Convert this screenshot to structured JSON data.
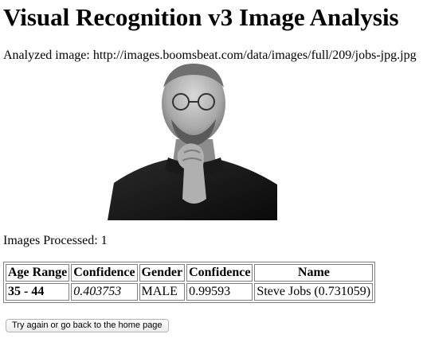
{
  "page": {
    "title": "Visual Recognition v3 Image Analysis",
    "analyzed_label": "Analyzed image: ",
    "analyzed_url": "http://images.boomsbeat.com/data/images/full/209/jobs-jpg.jpg",
    "processed_label": "Images Processed: ",
    "processed_count": "1"
  },
  "results": {
    "headers": [
      "Age Range",
      "Confidence",
      "Gender",
      "Confidence",
      "Name"
    ],
    "row": {
      "age_range": "35 - 44",
      "age_confidence": "0.403753",
      "gender": "MALE",
      "gender_confidence": "0.99593",
      "name": "Steve Jobs (0.731059)"
    }
  },
  "actions": {
    "home_button": "Try again or go back to the home page"
  },
  "colors": {
    "background": "#ffffff",
    "text": "#000000",
    "table_border": "#808080"
  }
}
